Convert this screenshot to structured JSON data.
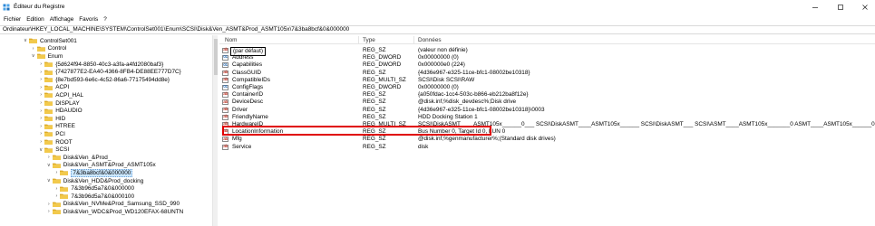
{
  "window": {
    "title": "Éditeur du Registre"
  },
  "menu": [
    "Fichier",
    "Edition",
    "Affichage",
    "Favoris",
    "?"
  ],
  "address": "Ordinateur\\HKEY_LOCAL_MACHINE\\SYSTEM\\ControlSet001\\Enum\\SCSI\\Disk&Ven_ASMT&Prod_ASMT105x\\7&3ba8bcf&0&000000",
  "tree": [
    {
      "label": "ControlSet001",
      "indent": 0,
      "expanded": true
    },
    {
      "label": "Control",
      "indent": 1,
      "expanded": false
    },
    {
      "label": "Enum",
      "indent": 1,
      "expanded": true
    },
    {
      "label": "{5d624f94-8850-40c3-a3fa-a4fd2080baf3}",
      "indent": 2,
      "expanded": false
    },
    {
      "label": "{7427877E2-EA40-4366-8FB4-DE88EE777D7C}",
      "indent": 2,
      "expanded": false
    },
    {
      "label": "{8e7bd593-6e6c-4c52-86a6-77175494dd8e}",
      "indent": 2,
      "expanded": false
    },
    {
      "label": "ACPI",
      "indent": 2,
      "expanded": false
    },
    {
      "label": "ACPI_HAL",
      "indent": 2,
      "expanded": false
    },
    {
      "label": "DISPLAY",
      "indent": 2,
      "expanded": false
    },
    {
      "label": "HDAUDIO",
      "indent": 2,
      "expanded": false
    },
    {
      "label": "HID",
      "indent": 2,
      "expanded": false
    },
    {
      "label": "HTREE",
      "indent": 2,
      "expanded": false
    },
    {
      "label": "PCI",
      "indent": 2,
      "expanded": false
    },
    {
      "label": "ROOT",
      "indent": 2,
      "expanded": false
    },
    {
      "label": "SCSI",
      "indent": 2,
      "expanded": true
    },
    {
      "label": "Disk&Ven_&Prod_",
      "indent": 3,
      "expanded": false
    },
    {
      "label": "Disk&Ven_ASMT&Prod_ASMT105x",
      "indent": 3,
      "expanded": true
    },
    {
      "label": "7&3ba8bcf&0&000000",
      "indent": 4,
      "expanded": false,
      "selected": true
    },
    {
      "label": "Disk&Ven_HDD&Prod_docking",
      "indent": 3,
      "expanded": true
    },
    {
      "label": "7&3b96d5a7&0&000000",
      "indent": 4,
      "expanded": false
    },
    {
      "label": "7&3b96d5a7&0&000100",
      "indent": 4,
      "expanded": false
    },
    {
      "label": "Disk&Ven_NVMe&Prod_Samsung_SSD_990",
      "indent": 3,
      "expanded": false
    },
    {
      "label": "Disk&Ven_WDC&Prod_WD120EFAX-68UNTN",
      "indent": 3,
      "expanded": false
    }
  ],
  "columns": {
    "name": "Nom",
    "type": "Type",
    "data": "Données"
  },
  "rows": [
    {
      "name": "(par défaut)",
      "type": "REG_SZ",
      "data": "(valeur non définie)",
      "icon": "ab",
      "editing": true
    },
    {
      "name": "Address",
      "type": "REG_DWORD",
      "data": "0x00000000 (0)",
      "icon": "bin"
    },
    {
      "name": "Capabilities",
      "type": "REG_DWORD",
      "data": "0x000000e0 (224)",
      "icon": "bin"
    },
    {
      "name": "ClassGUID",
      "type": "REG_SZ",
      "data": "{4d36e967-e325-11ce-bfc1-08002be10318}",
      "icon": "ab"
    },
    {
      "name": "CompatibleIDs",
      "type": "REG_MULTI_SZ",
      "data": "SCSI\\Disk SCSI\\RAW",
      "icon": "ab"
    },
    {
      "name": "ConfigFlags",
      "type": "REG_DWORD",
      "data": "0x00000000 (0)",
      "icon": "bin"
    },
    {
      "name": "ContainerID",
      "type": "REG_SZ",
      "data": "{a050fdac-1cc4-503c-b866-eb212ba8f12e}",
      "icon": "ab"
    },
    {
      "name": "DeviceDesc",
      "type": "REG_SZ",
      "data": "@disk.inf,%disk_devdesc%;Disk drive",
      "icon": "ab"
    },
    {
      "name": "Driver",
      "type": "REG_SZ",
      "data": "{4d36e967-e325-11ce-bfc1-08002be10318}\\0003",
      "icon": "ab"
    },
    {
      "name": "FriendlyName",
      "type": "REG_SZ",
      "data": "HDD Docking Station 1",
      "icon": "ab"
    },
    {
      "name": "HardwareID",
      "type": "REG_MULTI_SZ",
      "data": "SCSI\\DiskASMT____ASMT105x______0___ SCSI\\DiskASMT____ASMT105x______ SCSI\\DiskASMT___ SCSI\\ASMT____ASMT105x_______0 ASMT____ASMT105x______0 GenDisk",
      "icon": "ab"
    },
    {
      "name": "LocationInformation",
      "type": "REG_SZ",
      "data": "Bus Number 0, Target Id 0, LUN 0",
      "icon": "ab"
    },
    {
      "name": "Mfg",
      "type": "REG_SZ",
      "data": "@disk.inf,%genmanufacturer%;(Standard disk drives)",
      "icon": "ab"
    },
    {
      "name": "Service",
      "type": "REG_SZ",
      "data": "disk",
      "icon": "ab"
    }
  ],
  "colors": {
    "folder": "#f2c94c",
    "folder_dark": "#d9a520",
    "selection": "#cce8ff",
    "highlight": "#e00000",
    "value_icon_text": "#c0392b"
  }
}
